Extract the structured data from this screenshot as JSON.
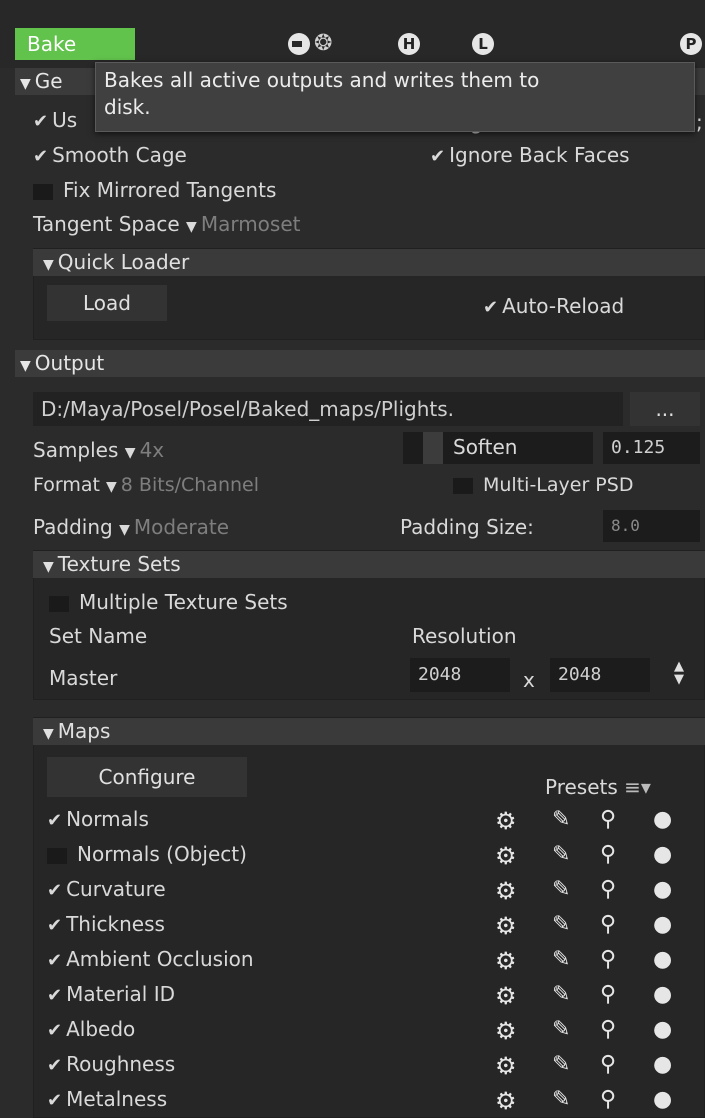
{
  "toolbar": {
    "bake_label": "Bake",
    "h_label": "H",
    "l_label": "L",
    "p_label": "P"
  },
  "tooltip": {
    "line1": "Bakes all active outputs and writes them to",
    "line2": "disk."
  },
  "general": {
    "header_fragment": "Ge",
    "use_fragment": "Us",
    "right_fragment_a": "g",
    "right_fragment_b": ";",
    "smooth_cage": "Smooth Cage",
    "ignore_back_faces": "Ignore Back Faces",
    "fix_mirrored_tangents": "Fix Mirrored Tangents",
    "tangent_space_label": "Tangent Space",
    "tangent_space_value": "Marmoset",
    "quick_loader": {
      "header": "Quick Loader",
      "load_label": "Load",
      "auto_reload": "Auto-Reload"
    }
  },
  "output": {
    "header": "Output",
    "path": "D:/Maya/Posel/Posel/Baked_maps/Plights.",
    "browse_label": "...",
    "samples_label": "Samples",
    "samples_value": "4x",
    "soften_label": "Soften",
    "soften_value": "0.125",
    "format_label": "Format",
    "format_value": "8 Bits/Channel",
    "multi_layer_psd": "Multi-Layer PSD",
    "padding_label": "Padding",
    "padding_value": "Moderate",
    "padding_size_label": "Padding Size:",
    "padding_size_value": "8.0",
    "texture_sets": {
      "header": "Texture Sets",
      "multiple_label": "Multiple Texture Sets",
      "set_name_header": "Set Name",
      "resolution_header": "Resolution",
      "set_name": "Master",
      "width": "2048",
      "x_label": "x",
      "height": "2048"
    }
  },
  "maps": {
    "header": "Maps",
    "configure_label": "Configure",
    "presets_label": "Presets",
    "items": [
      {
        "label": "Normals",
        "checked": true
      },
      {
        "label": "Normals (Object)",
        "checked": false
      },
      {
        "label": "Curvature",
        "checked": true
      },
      {
        "label": "Thickness",
        "checked": true
      },
      {
        "label": "Ambient Occlusion",
        "checked": true
      },
      {
        "label": "Material ID",
        "checked": true
      },
      {
        "label": "Albedo",
        "checked": true
      },
      {
        "label": "Roughness",
        "checked": true
      },
      {
        "label": "Metalness",
        "checked": true
      }
    ]
  }
}
